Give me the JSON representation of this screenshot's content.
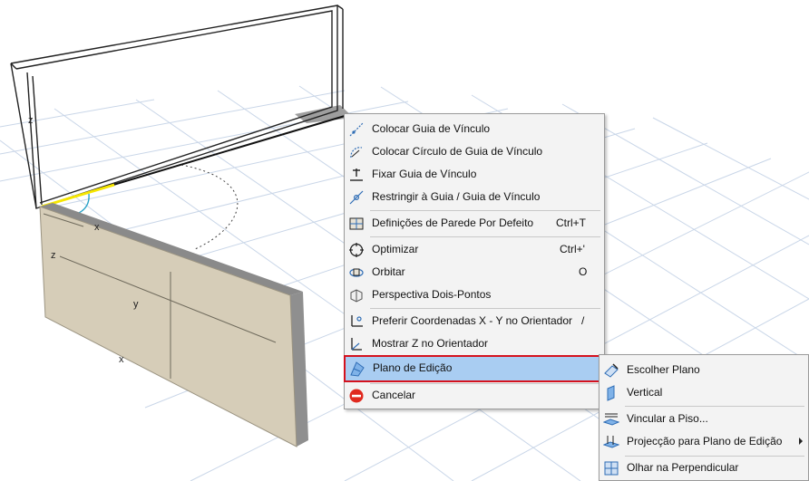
{
  "context_menu": {
    "items": [
      {
        "label": "Colocar Guia de Vínculo",
        "shortcut": ""
      },
      {
        "label": "Colocar Círculo de Guia de Vínculo",
        "shortcut": ""
      },
      {
        "label": "Fixar Guia de Vínculo",
        "shortcut": ""
      },
      {
        "label": "Restringir à Guia / Guia de Vínculo",
        "shortcut": ""
      },
      {
        "label": "Definições de Parede Por Defeito",
        "shortcut": "Ctrl+T"
      },
      {
        "label": "Optimizar",
        "shortcut": "Ctrl+'"
      },
      {
        "label": "Orbitar",
        "shortcut": "O"
      },
      {
        "label": "Perspectiva Dois-Pontos",
        "shortcut": ""
      },
      {
        "label": "Preferir Coordenadas X - Y no Orientador",
        "shortcut": "/"
      },
      {
        "label": "Mostrar Z no Orientador",
        "shortcut": ""
      },
      {
        "label": "Plano de Edição",
        "shortcut": ""
      },
      {
        "label": "Cancelar",
        "shortcut": ""
      }
    ]
  },
  "submenu": {
    "items": [
      {
        "label": "Escolher Plano"
      },
      {
        "label": "Vertical"
      },
      {
        "label": "Vincular a Piso..."
      },
      {
        "label": "Projecção para Plano de Edição"
      },
      {
        "label": "Olhar na Perpendicular"
      }
    ]
  },
  "viewport": {
    "axis_labels": {
      "z_top": "z",
      "x_top": "x",
      "z_wall": "z",
      "y_wall": "y",
      "x_wall": "x"
    }
  },
  "colors": {
    "menu_bg": "#f3f3f3",
    "highlight": "#a9cdf2",
    "highlight_border": "#d4121e",
    "wall_face": "#d6cdb8",
    "wall_side": "#8f8f8f",
    "grid": "#c5d3e6",
    "guide_yellow": "#f6e600"
  }
}
